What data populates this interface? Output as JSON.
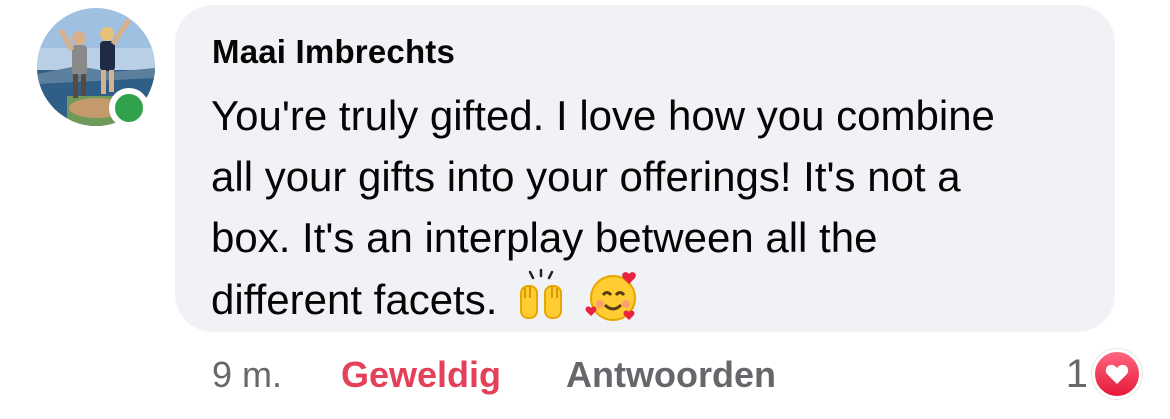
{
  "comment": {
    "author": "Maai Imbrechts",
    "text_line1": "You're truly gifted. I love how you combine",
    "text_line2": "all your gifts into your offerings! It's not a",
    "text_line3": "box. It's an interplay between all the",
    "text_line4": "different facets.",
    "emojis": [
      "raising-hands",
      "smiling-face-with-hearts"
    ],
    "online": true
  },
  "actions": {
    "timestamp": "9 m.",
    "reaction_label": "Geweldig",
    "reply_label": "Antwoorden"
  },
  "reactions": {
    "count": "1",
    "type": "love-icon"
  },
  "colors": {
    "bubble": "#f0f2f5",
    "online": "#31a24c",
    "reaction_text": "#e4405a",
    "meta_text": "#65676b"
  }
}
